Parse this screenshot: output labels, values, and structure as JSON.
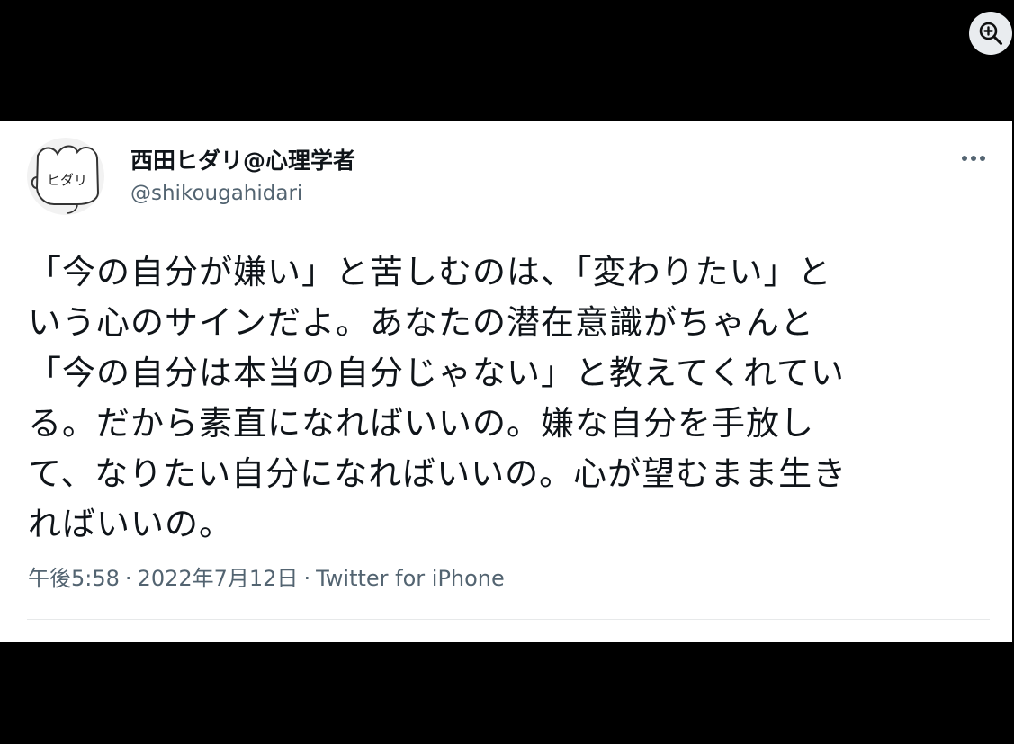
{
  "viewer": {
    "zoom_icon": "zoom-in-icon",
    "background": "#000000"
  },
  "tweet": {
    "author": {
      "display_name": "西田ヒダリ@心理学者",
      "handle": "@shikougahidari",
      "avatar_text": "ヒダリ"
    },
    "more_icon": "more-horizontal-icon",
    "text_lines": [
      "「今の自分が嫌い」と苦しむのは、「変わりたい」と",
      "いう心のサインだよ。あなたの潜在意識がちゃんと",
      "「今の自分は本当の自分じゃない」と教えてくれてい",
      "る。だから素直になればいいの。嫌な自分を手放し",
      "て、なりたい自分になればいいの。心が望むまま生き",
      "ればいいの。"
    ],
    "time": "午後5:58",
    "date": "2022年7月12日",
    "source": "Twitter for iPhone",
    "separator": "·"
  },
  "colors": {
    "text": "#0f1419",
    "secondary": "#536471",
    "divider": "#e7e9ea",
    "card": "#ffffff"
  }
}
